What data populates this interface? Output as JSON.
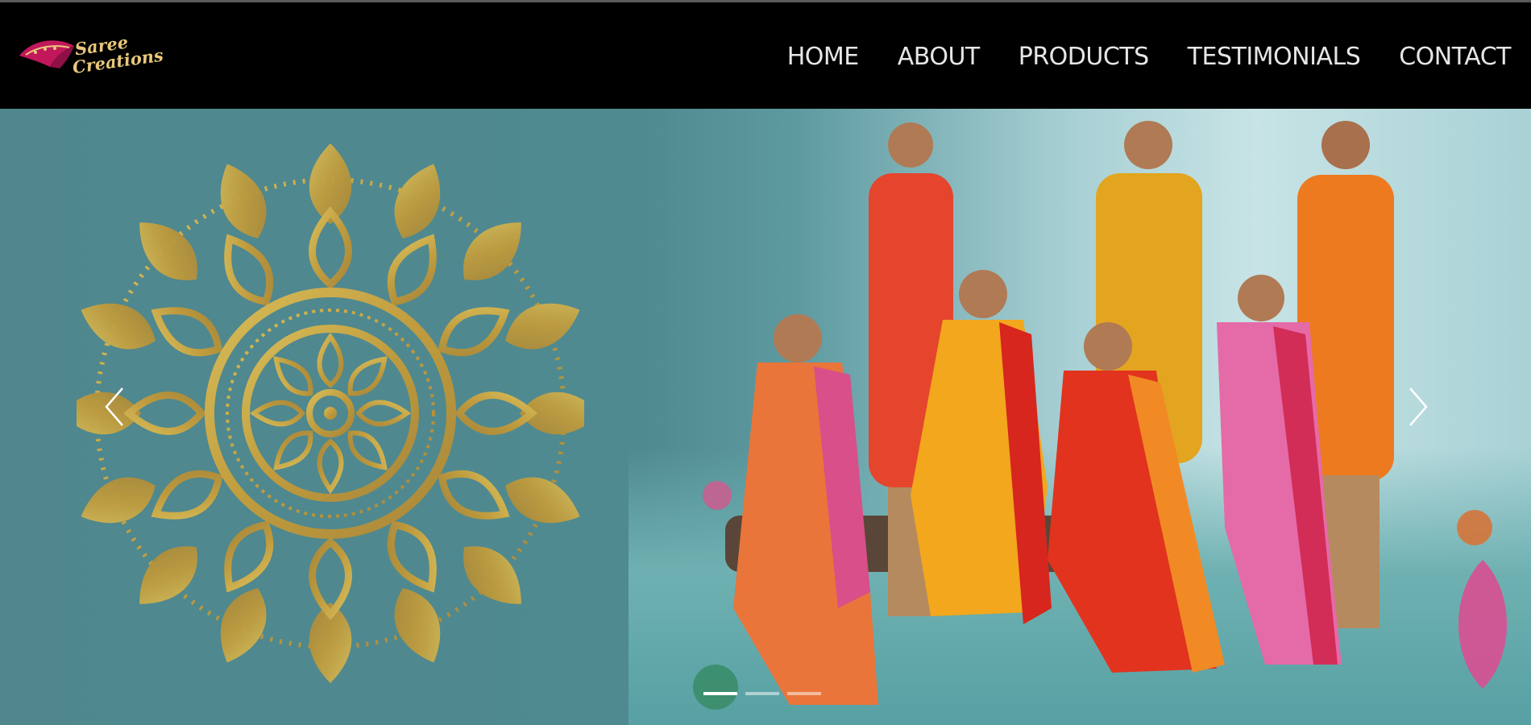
{
  "brand": {
    "line1": "Saree",
    "line2": "Creations",
    "logo_icon": "saree-swoosh-icon"
  },
  "nav": [
    {
      "label": "HOME"
    },
    {
      "label": "ABOUT"
    },
    {
      "label": "PRODUCTS"
    },
    {
      "label": "TESTIMONIALS"
    },
    {
      "label": "CONTACT"
    }
  ],
  "carousel": {
    "prev_icon": "chevron-left-icon",
    "next_icon": "chevron-right-icon",
    "slides": 3,
    "active_slide": 1
  },
  "colors": {
    "header_bg": "#000000",
    "nav_text": "#e6e6e6",
    "hero_teal": "#4f878d",
    "mandala_gold": "#c8a846"
  }
}
